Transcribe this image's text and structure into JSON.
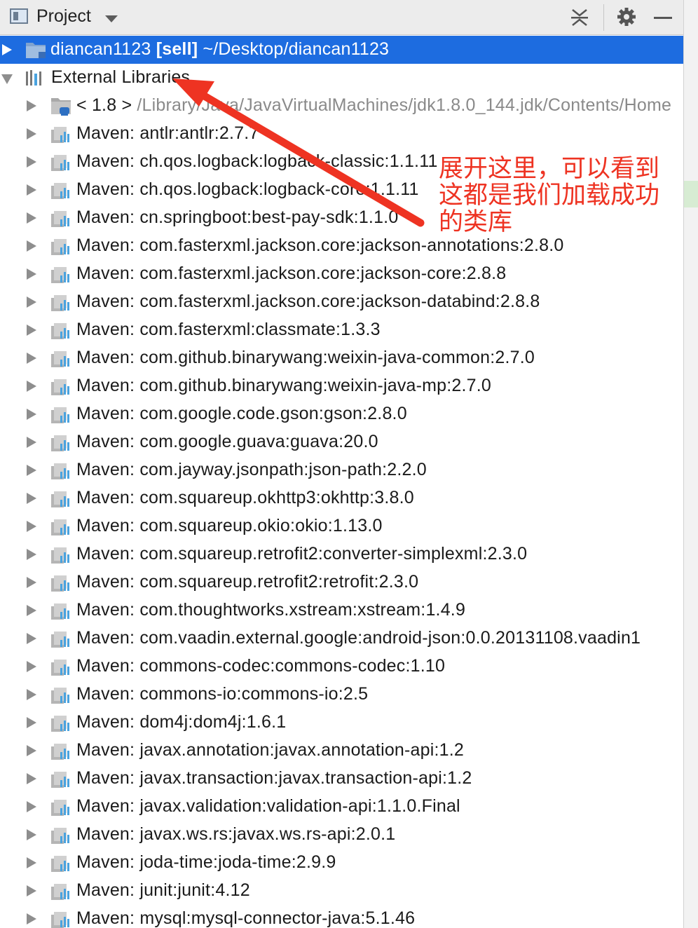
{
  "toolbar": {
    "title": "Project",
    "icons": [
      "project-view-icon",
      "dropdown-caret-icon",
      "collapse-all-icon",
      "gear-icon",
      "minimize-icon"
    ]
  },
  "tree": {
    "project_row": {
      "name": "diancan1123",
      "module": "[sell]",
      "path": "~/Desktop/diancan1123"
    },
    "external_libraries": "External Libraries",
    "jdk_row": {
      "name": "< 1.8 >",
      "path": "/Library/Java/JavaVirtualMachines/jdk1.8.0_144.jdk/Contents/Home"
    },
    "maven_libs": [
      "Maven: antlr:antlr:2.7.7",
      "Maven: ch.qos.logback:logback-classic:1.1.11",
      "Maven: ch.qos.logback:logback-core:1.1.11",
      "Maven: cn.springboot:best-pay-sdk:1.1.0",
      "Maven: com.fasterxml.jackson.core:jackson-annotations:2.8.0",
      "Maven: com.fasterxml.jackson.core:jackson-core:2.8.8",
      "Maven: com.fasterxml.jackson.core:jackson-databind:2.8.8",
      "Maven: com.fasterxml:classmate:1.3.3",
      "Maven: com.github.binarywang:weixin-java-common:2.7.0",
      "Maven: com.github.binarywang:weixin-java-mp:2.7.0",
      "Maven: com.google.code.gson:gson:2.8.0",
      "Maven: com.google.guava:guava:20.0",
      "Maven: com.jayway.jsonpath:json-path:2.2.0",
      "Maven: com.squareup.okhttp3:okhttp:3.8.0",
      "Maven: com.squareup.okio:okio:1.13.0",
      "Maven: com.squareup.retrofit2:converter-simplexml:2.3.0",
      "Maven: com.squareup.retrofit2:retrofit:2.3.0",
      "Maven: com.thoughtworks.xstream:xstream:1.4.9",
      "Maven: com.vaadin.external.google:android-json:0.0.20131108.vaadin1",
      "Maven: commons-codec:commons-codec:1.10",
      "Maven: commons-io:commons-io:2.5",
      "Maven: dom4j:dom4j:1.6.1",
      "Maven: javax.annotation:javax.annotation-api:1.2",
      "Maven: javax.transaction:javax.transaction-api:1.2",
      "Maven: javax.validation:validation-api:1.1.0.Final",
      "Maven: javax.ws.rs:javax.ws.rs-api:2.0.1",
      "Maven: joda-time:joda-time:2.9.9",
      "Maven: junit:junit:4.12",
      "Maven: mysql:mysql-connector-java:5.1.46"
    ]
  },
  "annotation": {
    "text": "展开这里，可以看到这都是我们加载成功的类库",
    "color": "#ee3322"
  },
  "colors": {
    "selection": "#1d6ce0",
    "toolbar_bg": "#ececec",
    "muted_text": "#8a8a8a"
  }
}
